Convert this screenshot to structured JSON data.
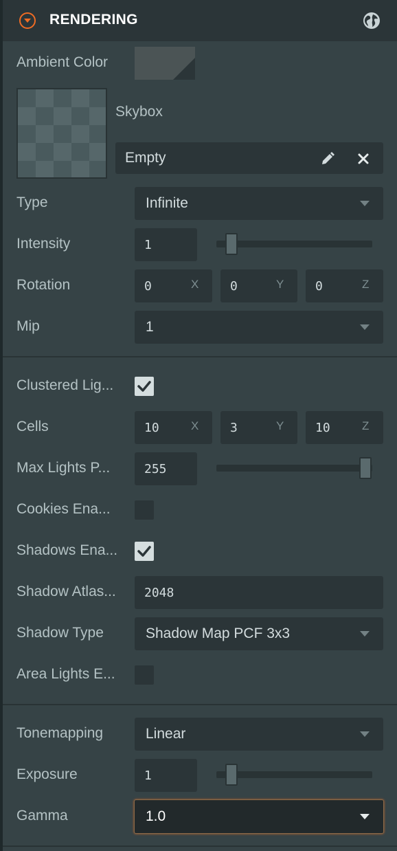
{
  "panel": {
    "title": "RENDERING",
    "icons": {
      "collapse": "chevron-down-circle-icon",
      "help": "globe-icon"
    }
  },
  "colors": {
    "accent": "#f06c24",
    "panel_bg": "#364346",
    "field_bg": "#2b3538",
    "ambient": "#4b5455"
  },
  "ambient": {
    "label": "Ambient Color"
  },
  "skybox": {
    "label": "Skybox",
    "value": "Empty",
    "edit_icon": "pencil-icon",
    "clear_icon": "close-icon"
  },
  "type": {
    "label": "Type",
    "value": "Infinite"
  },
  "intensity": {
    "label": "Intensity",
    "value": "1",
    "slider_fraction": 0.0
  },
  "rotation": {
    "label": "Rotation",
    "x": "0",
    "y": "0",
    "z": "0",
    "x_axis": "X",
    "y_axis": "Y",
    "z_axis": "Z"
  },
  "mip": {
    "label": "Mip",
    "value": "1"
  },
  "clustered": {
    "label": "Clustered Lig...",
    "checked": true
  },
  "cells": {
    "label": "Cells",
    "x": "10",
    "y": "3",
    "z": "10",
    "x_axis": "X",
    "y_axis": "Y",
    "z_axis": "Z"
  },
  "max_lights": {
    "label": "Max Lights P...",
    "value": "255",
    "slider_fraction": 1.0
  },
  "cookies": {
    "label": "Cookies Ena...",
    "checked": false
  },
  "shadows": {
    "label": "Shadows Ena...",
    "checked": true
  },
  "shadow_atlas": {
    "label": "Shadow Atlas...",
    "value": "2048"
  },
  "shadow_type": {
    "label": "Shadow Type",
    "value": "Shadow Map PCF 3x3"
  },
  "area_lights": {
    "label": "Area Lights E...",
    "checked": false
  },
  "tonemapping": {
    "label": "Tonemapping",
    "value": "Linear"
  },
  "exposure": {
    "label": "Exposure",
    "value": "1",
    "slider_fraction": 0.0
  },
  "gamma": {
    "label": "Gamma",
    "value": "1.0"
  }
}
